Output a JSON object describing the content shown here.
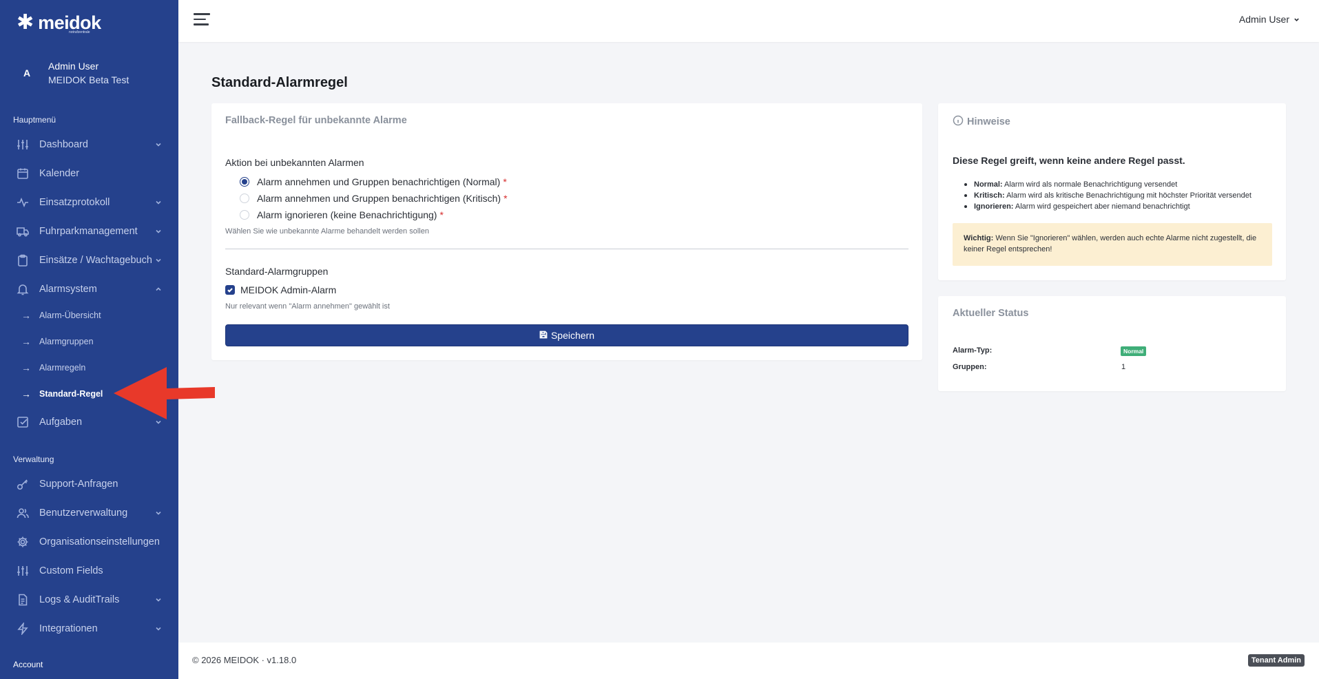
{
  "brand": {
    "name": "meidok",
    "tagline": "notrufzentrale"
  },
  "user": {
    "initial": "A",
    "name": "Admin User",
    "org": "MEIDOK Beta Test"
  },
  "sidebar": {
    "section_main": "Hauptmenü",
    "section_admin": "Verwaltung",
    "items": [
      {
        "label": "Dashboard",
        "icon": "sliders-icon"
      },
      {
        "label": "Kalender",
        "icon": "calendar-icon"
      },
      {
        "label": "Einsatzprotokoll",
        "icon": "activity-icon"
      },
      {
        "label": "Fuhrparkmanagement",
        "icon": "truck-icon"
      },
      {
        "label": "Einsätze / Wachtagebuch",
        "icon": "clipboard-icon"
      },
      {
        "label": "Alarmsystem",
        "icon": "bell-icon"
      },
      {
        "label": "Aufgaben",
        "icon": "checkbox-icon"
      },
      {
        "label": "Support-Anfragen",
        "icon": "key-icon"
      },
      {
        "label": "Benutzerverwaltung",
        "icon": "users-icon"
      },
      {
        "label": "Organisationseinstellungen",
        "icon": "gear-icon"
      },
      {
        "label": "Custom Fields",
        "icon": "sliders-icon"
      },
      {
        "label": "Logs & AuditTrails",
        "icon": "document-icon"
      },
      {
        "label": "Integrationen",
        "icon": "lightning-icon"
      }
    ],
    "sub_items": [
      "Alarm-Übersicht",
      "Alarmgruppen",
      "Alarmregeln",
      "Standard-Regel"
    ],
    "account": "Account"
  },
  "topbar": {
    "user_label": "Admin User"
  },
  "main": {
    "title": "Standard-Alarmregel",
    "form_card": {
      "title": "Fallback-Regel für unbekannte Alarme",
      "action_label": "Aktion bei unbekannten Alarmen",
      "options": [
        "Alarm annehmen und Gruppen benachrichtigen (Normal)",
        "Alarm annehmen und Gruppen benachrichtigen (Kritisch)",
        "Alarm ignorieren (keine Benachrichtigung)"
      ],
      "required_mark": "*",
      "action_help": "Wählen Sie wie unbekannte Alarme behandelt werden sollen",
      "groups_label": "Standard-Alarmgruppen",
      "group_option": "MEIDOK Admin-Alarm",
      "groups_help": "Nur relevant wenn \"Alarm annehmen\" gewählt ist",
      "save_label": "Speichern"
    },
    "hints_card": {
      "title": "Hinweise",
      "rule_text": "Diese Regel greift, wenn keine andere Regel passt.",
      "bullets": [
        {
          "term": "Normal:",
          "text": "Alarm wird als normale Benachrichtigung versendet"
        },
        {
          "term": "Kritisch:",
          "text": "Alarm wird als kritische Benachrichtigung mit höchster Priorität versendet"
        },
        {
          "term": "Ignorieren:",
          "text": "Alarm wird gespeichert aber niemand benachrichtigt"
        }
      ],
      "warning_term": "Wichtig:",
      "warning_text": "Wenn Sie \"Ignorieren\" wählen, werden auch echte Alarme nicht zugestellt, die keiner Regel entsprechen!"
    },
    "status_card": {
      "title": "Aktueller Status",
      "type_label": "Alarm-Typ:",
      "type_value": "Normal",
      "groups_label": "Gruppen:",
      "groups_value": "1"
    }
  },
  "footer": {
    "copyright": "© 2026 MEIDOK · v1.18.0",
    "role_badge": "Tenant Admin"
  },
  "colors": {
    "sidebar": "#25418c",
    "accent": "#25418c",
    "badge_green": "#3fae78",
    "warning_bg": "#fcefd2",
    "annotation_red": "#e8392a"
  }
}
